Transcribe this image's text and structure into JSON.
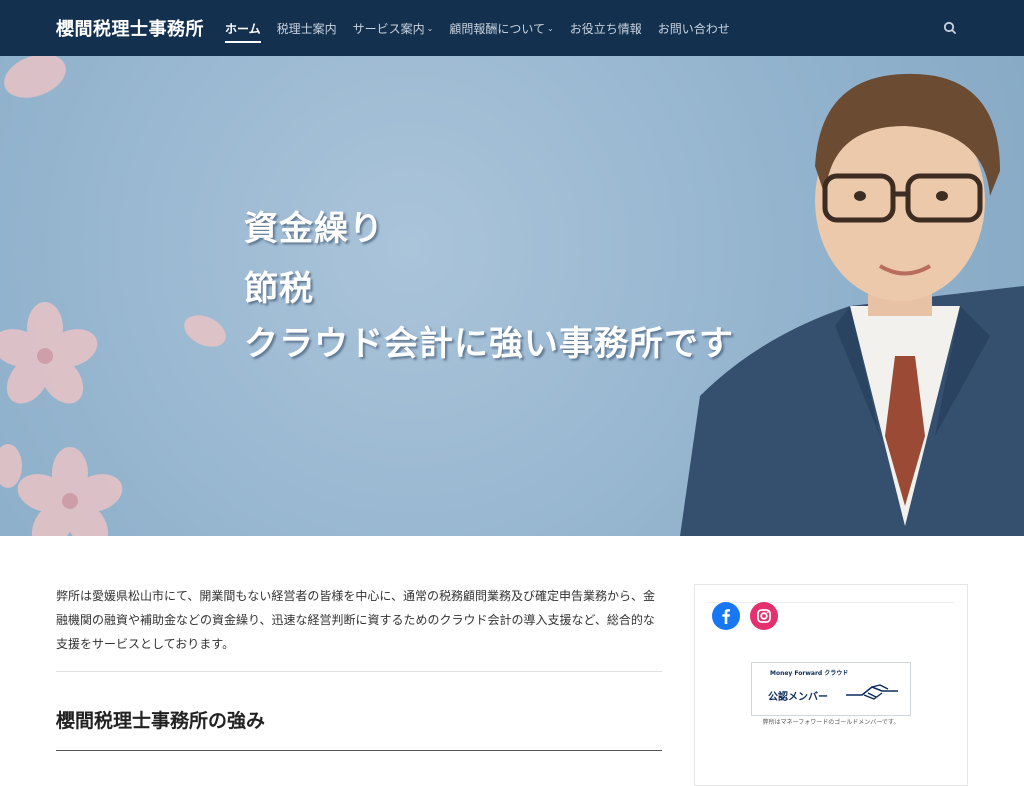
{
  "site": {
    "title": "櫻間税理士事務所"
  },
  "nav": {
    "items": [
      {
        "label": "ホーム",
        "active": true
      },
      {
        "label": "税理士案内"
      },
      {
        "label": "サービス案内",
        "dropdown": true
      },
      {
        "label": "顧問報酬について",
        "dropdown": true
      },
      {
        "label": "お役立ち情報"
      },
      {
        "label": "お問い合わせ"
      }
    ],
    "search_icon": "search-icon"
  },
  "hero": {
    "lines": [
      "資金繰り",
      "節税",
      "クラウド会計に強い事務所です"
    ]
  },
  "main": {
    "intro": "弊所は愛媛県松山市にて、開業間もない経営者の皆様を中心に、通常の税務顧問業務及び確定申告業務から、金融機関の融資や補助金などの資金繰り、迅速な経営判断に資するためのクラウド会計の導入支援など、総合的な支援をサービスとしております。",
    "section_title": "櫻間税理士事務所の強み"
  },
  "sidebar": {
    "social": [
      "facebook-icon",
      "instagram-icon"
    ],
    "banner": {
      "brand": "Money Forward クラウド",
      "badge": "公認メンバー",
      "caption": "弊所はマネーフォワードのゴールドメンバーです。"
    }
  },
  "colors": {
    "header_bg": "#13304e",
    "hero_bg": "#94b4ce",
    "facebook": "#1877f2",
    "instagram": "#e4306c"
  }
}
